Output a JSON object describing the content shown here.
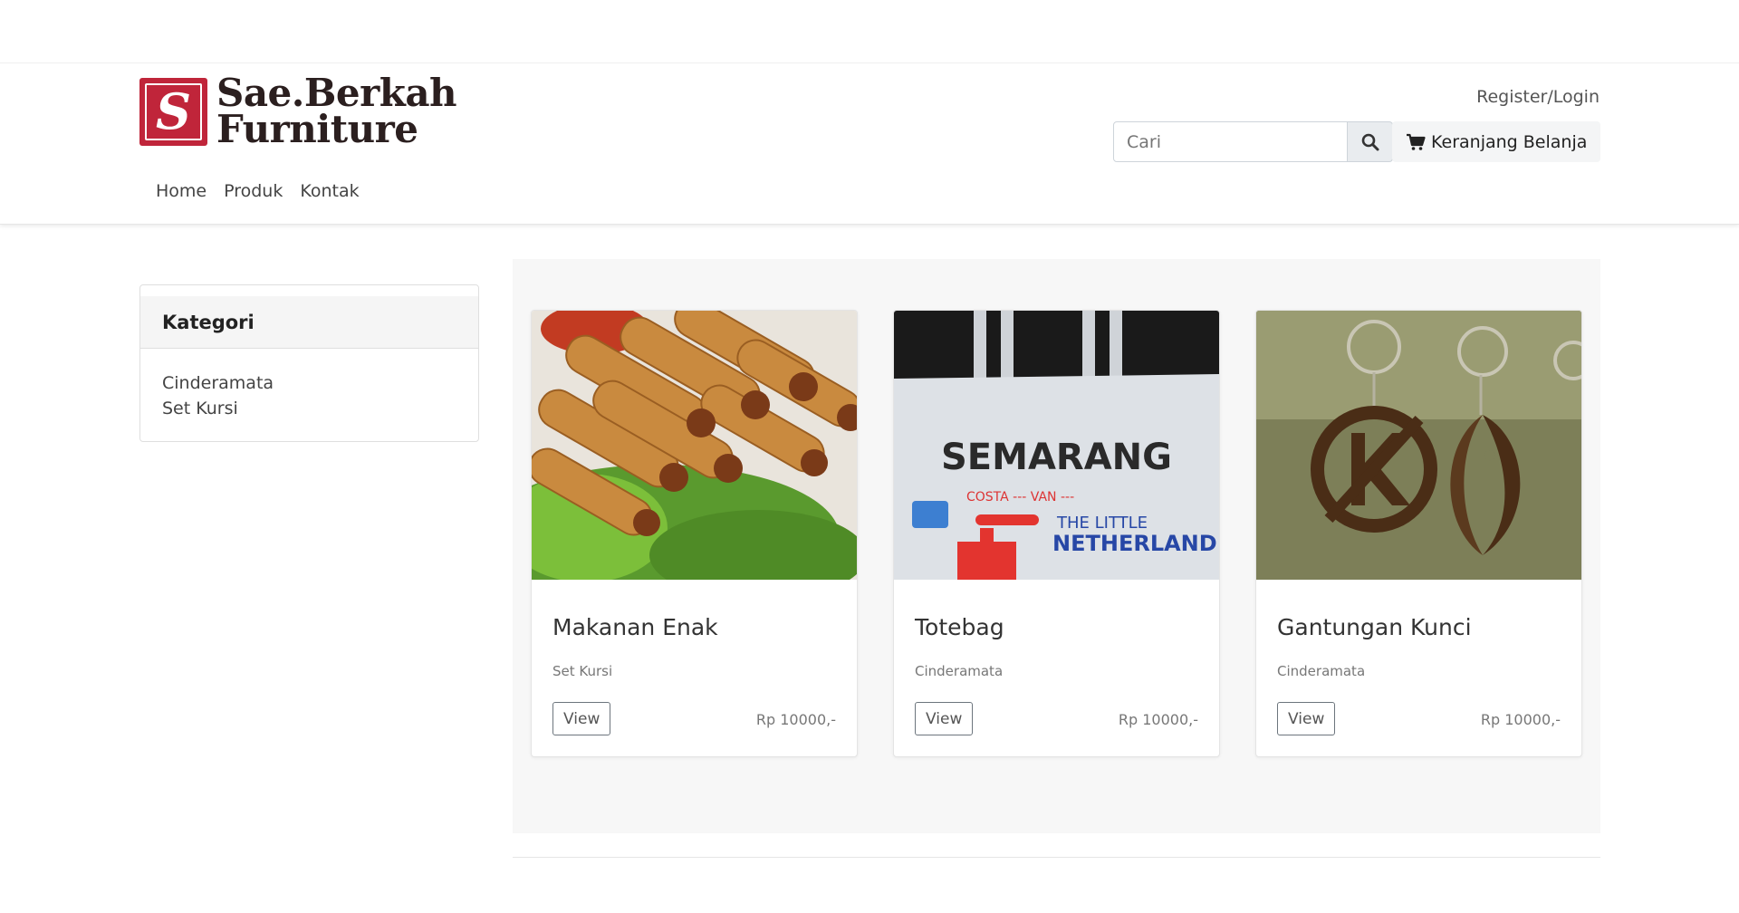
{
  "brand": {
    "mark": "S",
    "line1": "Sae.Berkah",
    "line2": "Furniture",
    "accent": "#c0253a"
  },
  "nav": {
    "items": [
      "Home",
      "Produk",
      "Kontak"
    ]
  },
  "header": {
    "register_login": "Register/Login",
    "search_placeholder": "Cari",
    "search_icon": "search-icon",
    "cart_icon": "cart-icon",
    "cart_label": "Keranjang Belanja"
  },
  "sidebar": {
    "title": "Kategori",
    "items": [
      "Cinderamata",
      "Set Kursi"
    ]
  },
  "products": [
    {
      "title": "Makanan Enak",
      "category": "Set Kursi",
      "view_label": "View",
      "price": "Rp 10000,-",
      "image": "spring-rolls-photo"
    },
    {
      "title": "Totebag",
      "category": "Cinderamata",
      "view_label": "View",
      "price": "Rp 10000,-",
      "image": "semarang-totebag-photo"
    },
    {
      "title": "Gantungan Kunci",
      "category": "Cinderamata",
      "view_label": "View",
      "price": "Rp 10000,-",
      "image": "wooden-keychain-photo"
    }
  ]
}
